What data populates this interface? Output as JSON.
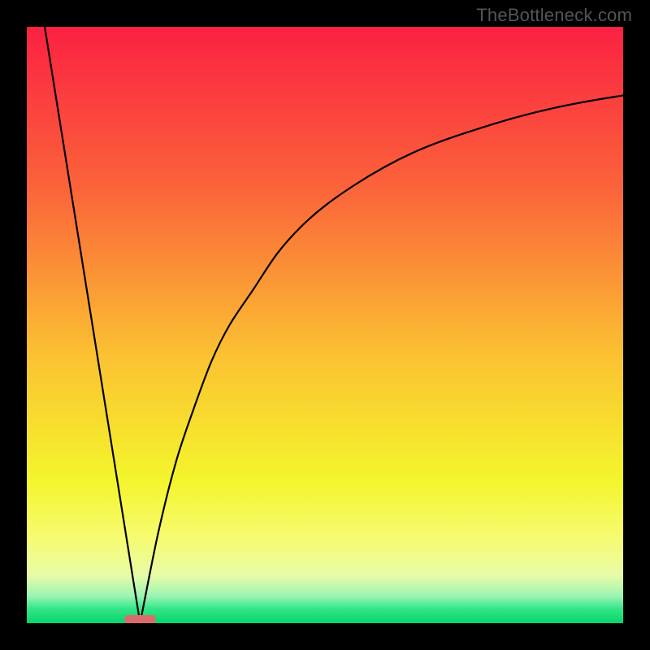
{
  "watermark": "TheBottleneck.com",
  "chart_data": {
    "type": "line",
    "title": "",
    "xlabel": "",
    "ylabel": "",
    "xlim": [
      0,
      100
    ],
    "ylim": [
      0,
      100
    ],
    "notch_x": 19,
    "marker": {
      "x": 19,
      "y": 0,
      "color": "#de6b6b"
    },
    "series": [
      {
        "name": "left-branch",
        "x": [
          3,
          19
        ],
        "y": [
          100,
          0
        ]
      },
      {
        "name": "right-branch",
        "x": [
          19,
          22,
          25,
          28,
          31,
          34,
          38,
          42,
          46,
          50,
          55,
          60,
          65,
          70,
          76,
          82,
          88,
          94,
          100
        ],
        "y": [
          0,
          15,
          27,
          36,
          44,
          50,
          56,
          62,
          66.5,
          70,
          73.5,
          76.5,
          79,
          81,
          83,
          84.8,
          86.3,
          87.5,
          88.5
        ]
      }
    ],
    "background_gradient": {
      "stops": [
        {
          "offset": 0.0,
          "color": "#fb2142"
        },
        {
          "offset": 0.28,
          "color": "#fb663a"
        },
        {
          "offset": 0.55,
          "color": "#fbc132"
        },
        {
          "offset": 0.76,
          "color": "#f4f52c"
        },
        {
          "offset": 0.86,
          "color": "#f6fb73"
        },
        {
          "offset": 0.92,
          "color": "#e7fba7"
        },
        {
          "offset": 0.955,
          "color": "#9bf4b3"
        },
        {
          "offset": 0.975,
          "color": "#34e789"
        },
        {
          "offset": 1.0,
          "color": "#08d46a"
        }
      ]
    }
  }
}
